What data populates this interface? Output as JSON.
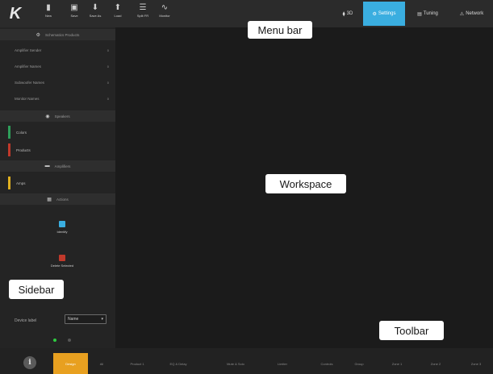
{
  "menubar": {
    "logo": "K",
    "buttons": [
      {
        "icon": "file-icon",
        "label": "New"
      },
      {
        "icon": "save-icon",
        "label": "Save"
      },
      {
        "icon": "save-as-icon",
        "label": "Save As"
      },
      {
        "icon": "load-icon",
        "label": "Load"
      },
      {
        "icon": "split-icon",
        "label": "Split FR"
      },
      {
        "icon": "monitor-icon",
        "label": "Monitor"
      }
    ],
    "right_tabs": [
      {
        "icon": "3d-icon",
        "label": "3D",
        "active": false
      },
      {
        "icon": "settings-icon",
        "label": "Settings",
        "active": true
      },
      {
        "icon": "tuning-icon",
        "label": "Tuning",
        "active": false
      },
      {
        "icon": "network-icon",
        "label": "Network",
        "active": false
      }
    ]
  },
  "sidebar": {
    "header_title": "Schematics Products",
    "rows": [
      {
        "label": "Amplifier Sender",
        "badge": "0"
      },
      {
        "label": "Amplifier Names",
        "badge": "0"
      },
      {
        "label": "Subwoofer Names",
        "badge": "0"
      },
      {
        "label": "Monitor Names",
        "badge": "0"
      }
    ],
    "sections": [
      {
        "title": "Speakers",
        "icon": "speaker-icon"
      },
      {
        "title": "Amplifiers",
        "icon": "amplifier-icon"
      },
      {
        "title": "Actions",
        "icon": "actions-icon"
      }
    ],
    "speakers": [
      {
        "label": "Colors",
        "color": "#2e9e5a"
      },
      {
        "label": "Products",
        "color": "#c0392b"
      }
    ],
    "amplifiers": [
      {
        "label": "Amps",
        "color": "#e0b020"
      }
    ],
    "actions": [
      {
        "label": "Identify",
        "color": "#3aaee0"
      },
      {
        "label": "Delete Selected",
        "color": "#c0392b"
      }
    ],
    "device_label": {
      "label": "Device label",
      "value": "Name"
    },
    "status_dots": [
      {
        "color": "#2ecc40"
      },
      {
        "color": "#555555"
      }
    ]
  },
  "toolbar": {
    "info_icon": "i",
    "tabs": [
      {
        "label": "Design",
        "active": true
      },
      {
        "label": "All",
        "active": false
      },
      {
        "label": "Product 1",
        "active": false
      },
      {
        "label": "EQ & Delay",
        "active": false
      },
      {
        "label": "Mute & Solo",
        "active": false
      },
      {
        "label": "Limiter",
        "active": false
      },
      {
        "label": "Controls",
        "active": false
      },
      {
        "label": "Group",
        "active": false
      },
      {
        "label": "Zone 1",
        "active": false
      },
      {
        "label": "Zone 2",
        "active": false
      },
      {
        "label": "Zone 3",
        "active": false
      }
    ]
  },
  "callouts": {
    "menu_bar": "Menu bar",
    "workspace": "Workspace",
    "sidebar": "Sidebar",
    "toolbar": "Toolbar"
  }
}
